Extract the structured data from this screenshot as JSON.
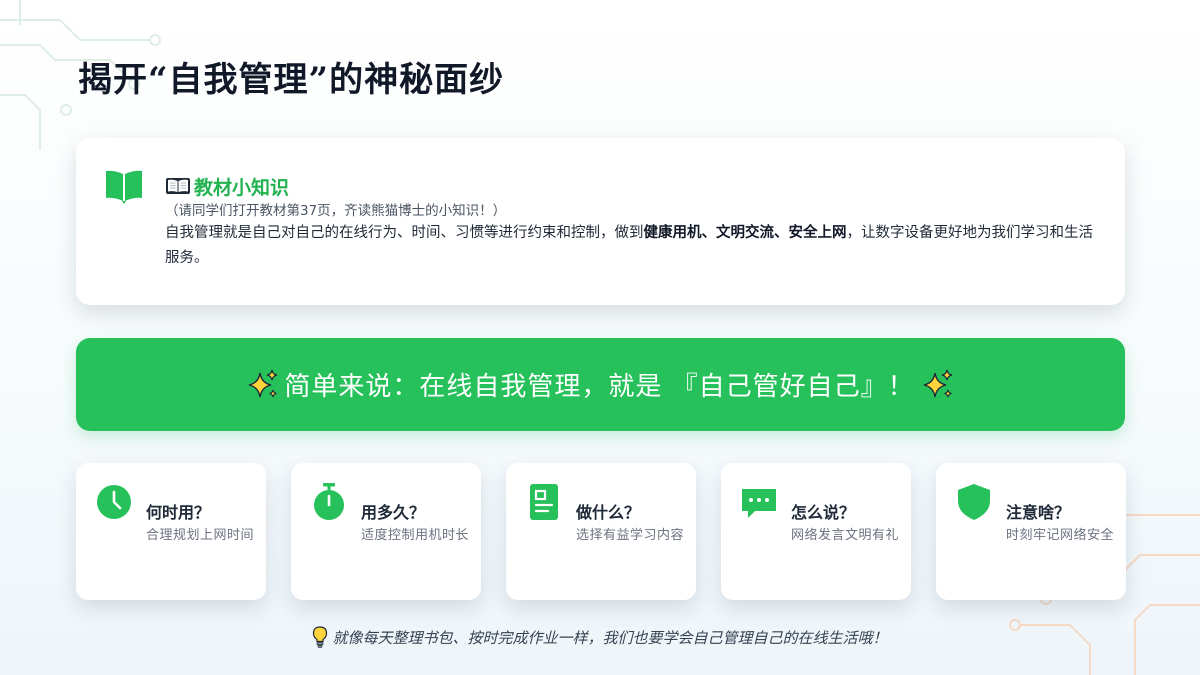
{
  "page": {
    "title": "揭开“自我管理”的神秘面纱"
  },
  "knowledge": {
    "icon": "book-icon",
    "title": "📖教材小知识",
    "title_text": "教材小知识",
    "note": "（请同学们打开教材第37页，齐读熊猫博士的小知识！）",
    "text_part1": "自我管理就是自己对自己的在线行为、时间、习惯等进行约束和控制，做到",
    "text_bold": "健康用机、文明交流、安全上网",
    "text_part2": "，让数字设备更好地为我们学习和生活服务。"
  },
  "banner": {
    "icon_left": "sparkles-icon",
    "icon_right": "sparkles-icon",
    "text": "简单来说：在线自我管理，就是 『自己管好自己』！"
  },
  "tips": [
    {
      "icon": "clock-icon",
      "title": "何时用？",
      "desc": "合理规划上网时间"
    },
    {
      "icon": "stopwatch-icon",
      "title": "用多久？",
      "desc": "适度控制用机时长"
    },
    {
      "icon": "document-icon",
      "title": "做什么？",
      "desc": "选择有益学习内容"
    },
    {
      "icon": "chat-icon",
      "title": "怎么说？",
      "desc": "网络发言文明有礼"
    },
    {
      "icon": "shield-icon",
      "title": "注意啥？",
      "desc": "时刻牢记网络安全"
    }
  ],
  "footer": {
    "icon": "lightbulb-icon",
    "text": "就像每天整理书包、按时完成作业一样，我们也要学会自己管理自己的在线生活哦！"
  },
  "colors": {
    "accent_green": "#26c15a",
    "title_dark": "#111827",
    "card_bg": "#ffffff"
  }
}
